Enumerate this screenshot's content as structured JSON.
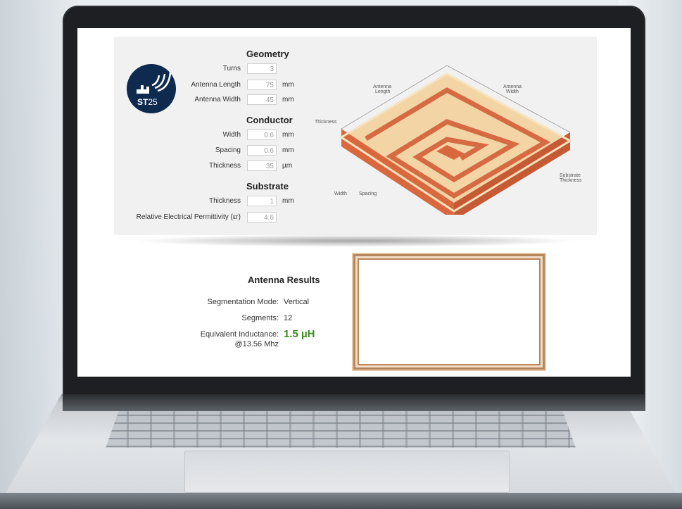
{
  "brand": {
    "logo_text_bold": "ST",
    "logo_text_rest": "25"
  },
  "geometry": {
    "title": "Geometry",
    "fields": [
      {
        "label": "Turns",
        "value": "3",
        "unit": ""
      },
      {
        "label": "Antenna Length",
        "value": "75",
        "unit": "mm"
      },
      {
        "label": "Antenna Width",
        "value": "45",
        "unit": "mm"
      }
    ]
  },
  "conductor": {
    "title": "Conductor",
    "fields": [
      {
        "label": "Width",
        "value": "0.6",
        "unit": "mm"
      },
      {
        "label": "Spacing",
        "value": "0.6",
        "unit": "mm"
      },
      {
        "label": "Thickness",
        "value": "35",
        "unit": "µm"
      }
    ]
  },
  "substrate": {
    "title": "Substrate",
    "fields": [
      {
        "label": "Thickness",
        "value": "1",
        "unit": "mm"
      },
      {
        "label": "Relative Electrical Permittivity (εr)",
        "value": "4.6",
        "unit": ""
      }
    ]
  },
  "diagram": {
    "antenna_length": "Antenna\nLength",
    "antenna_width": "Antenna\nWidth",
    "thickness": "Thickness",
    "width": "Width",
    "spacing": "Spacing",
    "substrate_thickness": "Substrate\nThickness"
  },
  "results": {
    "title": "Antenna Results",
    "segmentation_mode_label": "Segmentation Mode:",
    "segmentation_mode_value": "Vertical",
    "segments_label": "Segments:",
    "segments_value": "12",
    "inductance_label": "Equivalent Inductance:",
    "inductance_sub": "@13.56 Mhz",
    "inductance_value": "1.5 µH"
  },
  "colors": {
    "logo_bg": "#0e2a4f",
    "copper": "#d9683f",
    "trace": "#f6dfae",
    "result_green": "#3a8a20"
  }
}
